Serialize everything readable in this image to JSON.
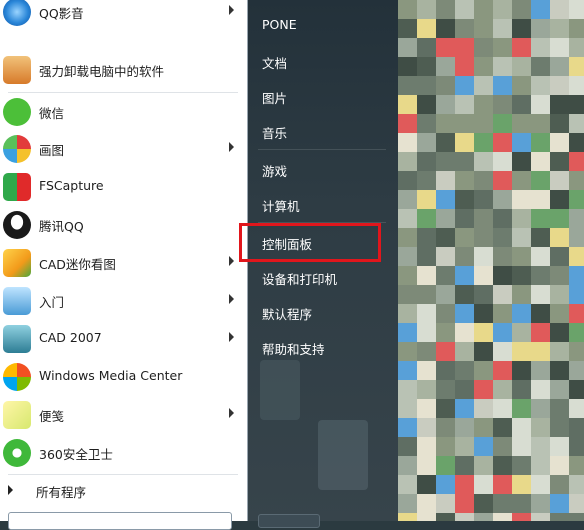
{
  "start_menu": {
    "programs": [
      {
        "label": "QQ影音",
        "icon": "qq-video-icon",
        "has_submenu": true
      },
      {
        "label": "强力卸载电脑中的软件",
        "icon": "uninstall-box-icon",
        "has_submenu": false
      },
      {
        "label": "微信",
        "icon": "wechat-icon",
        "has_submenu": false
      },
      {
        "label": "画图",
        "icon": "paint-palette-icon",
        "has_submenu": true
      },
      {
        "label": "FSCapture",
        "icon": "fscapture-icon",
        "has_submenu": false
      },
      {
        "label": "腾讯QQ",
        "icon": "qq-penguin-icon",
        "has_submenu": false
      },
      {
        "label": "CAD迷你看图",
        "icon": "cad-viewer-icon",
        "has_submenu": true
      },
      {
        "label": "入门",
        "icon": "getting-started-icon",
        "has_submenu": true
      },
      {
        "label": "CAD 2007",
        "icon": "autocad-icon",
        "has_submenu": true
      },
      {
        "label": "Windows Media Center",
        "icon": "windows-media-center-icon",
        "has_submenu": false
      },
      {
        "label": "便笺",
        "icon": "sticky-notes-icon",
        "has_submenu": true
      },
      {
        "label": "360安全卫士",
        "icon": "360-security-icon",
        "has_submenu": false
      }
    ],
    "all_programs": "所有程序",
    "right_items": [
      {
        "label": "PONE",
        "name": "right-item-user"
      },
      {
        "label": "文档",
        "name": "right-item-documents"
      },
      {
        "label": "图片",
        "name": "right-item-pictures"
      },
      {
        "label": "音乐",
        "name": "right-item-music"
      },
      {
        "label": "游戏",
        "name": "right-item-games"
      },
      {
        "label": "计算机",
        "name": "right-item-computer"
      },
      {
        "label": "控制面板",
        "name": "right-item-control-panel"
      },
      {
        "label": "设备和打印机",
        "name": "right-item-devices-printers"
      },
      {
        "label": "默认程序",
        "name": "right-item-default-programs"
      },
      {
        "label": "帮助和支持",
        "name": "right-item-help-support"
      }
    ],
    "highlight_color": "#e1161c"
  }
}
